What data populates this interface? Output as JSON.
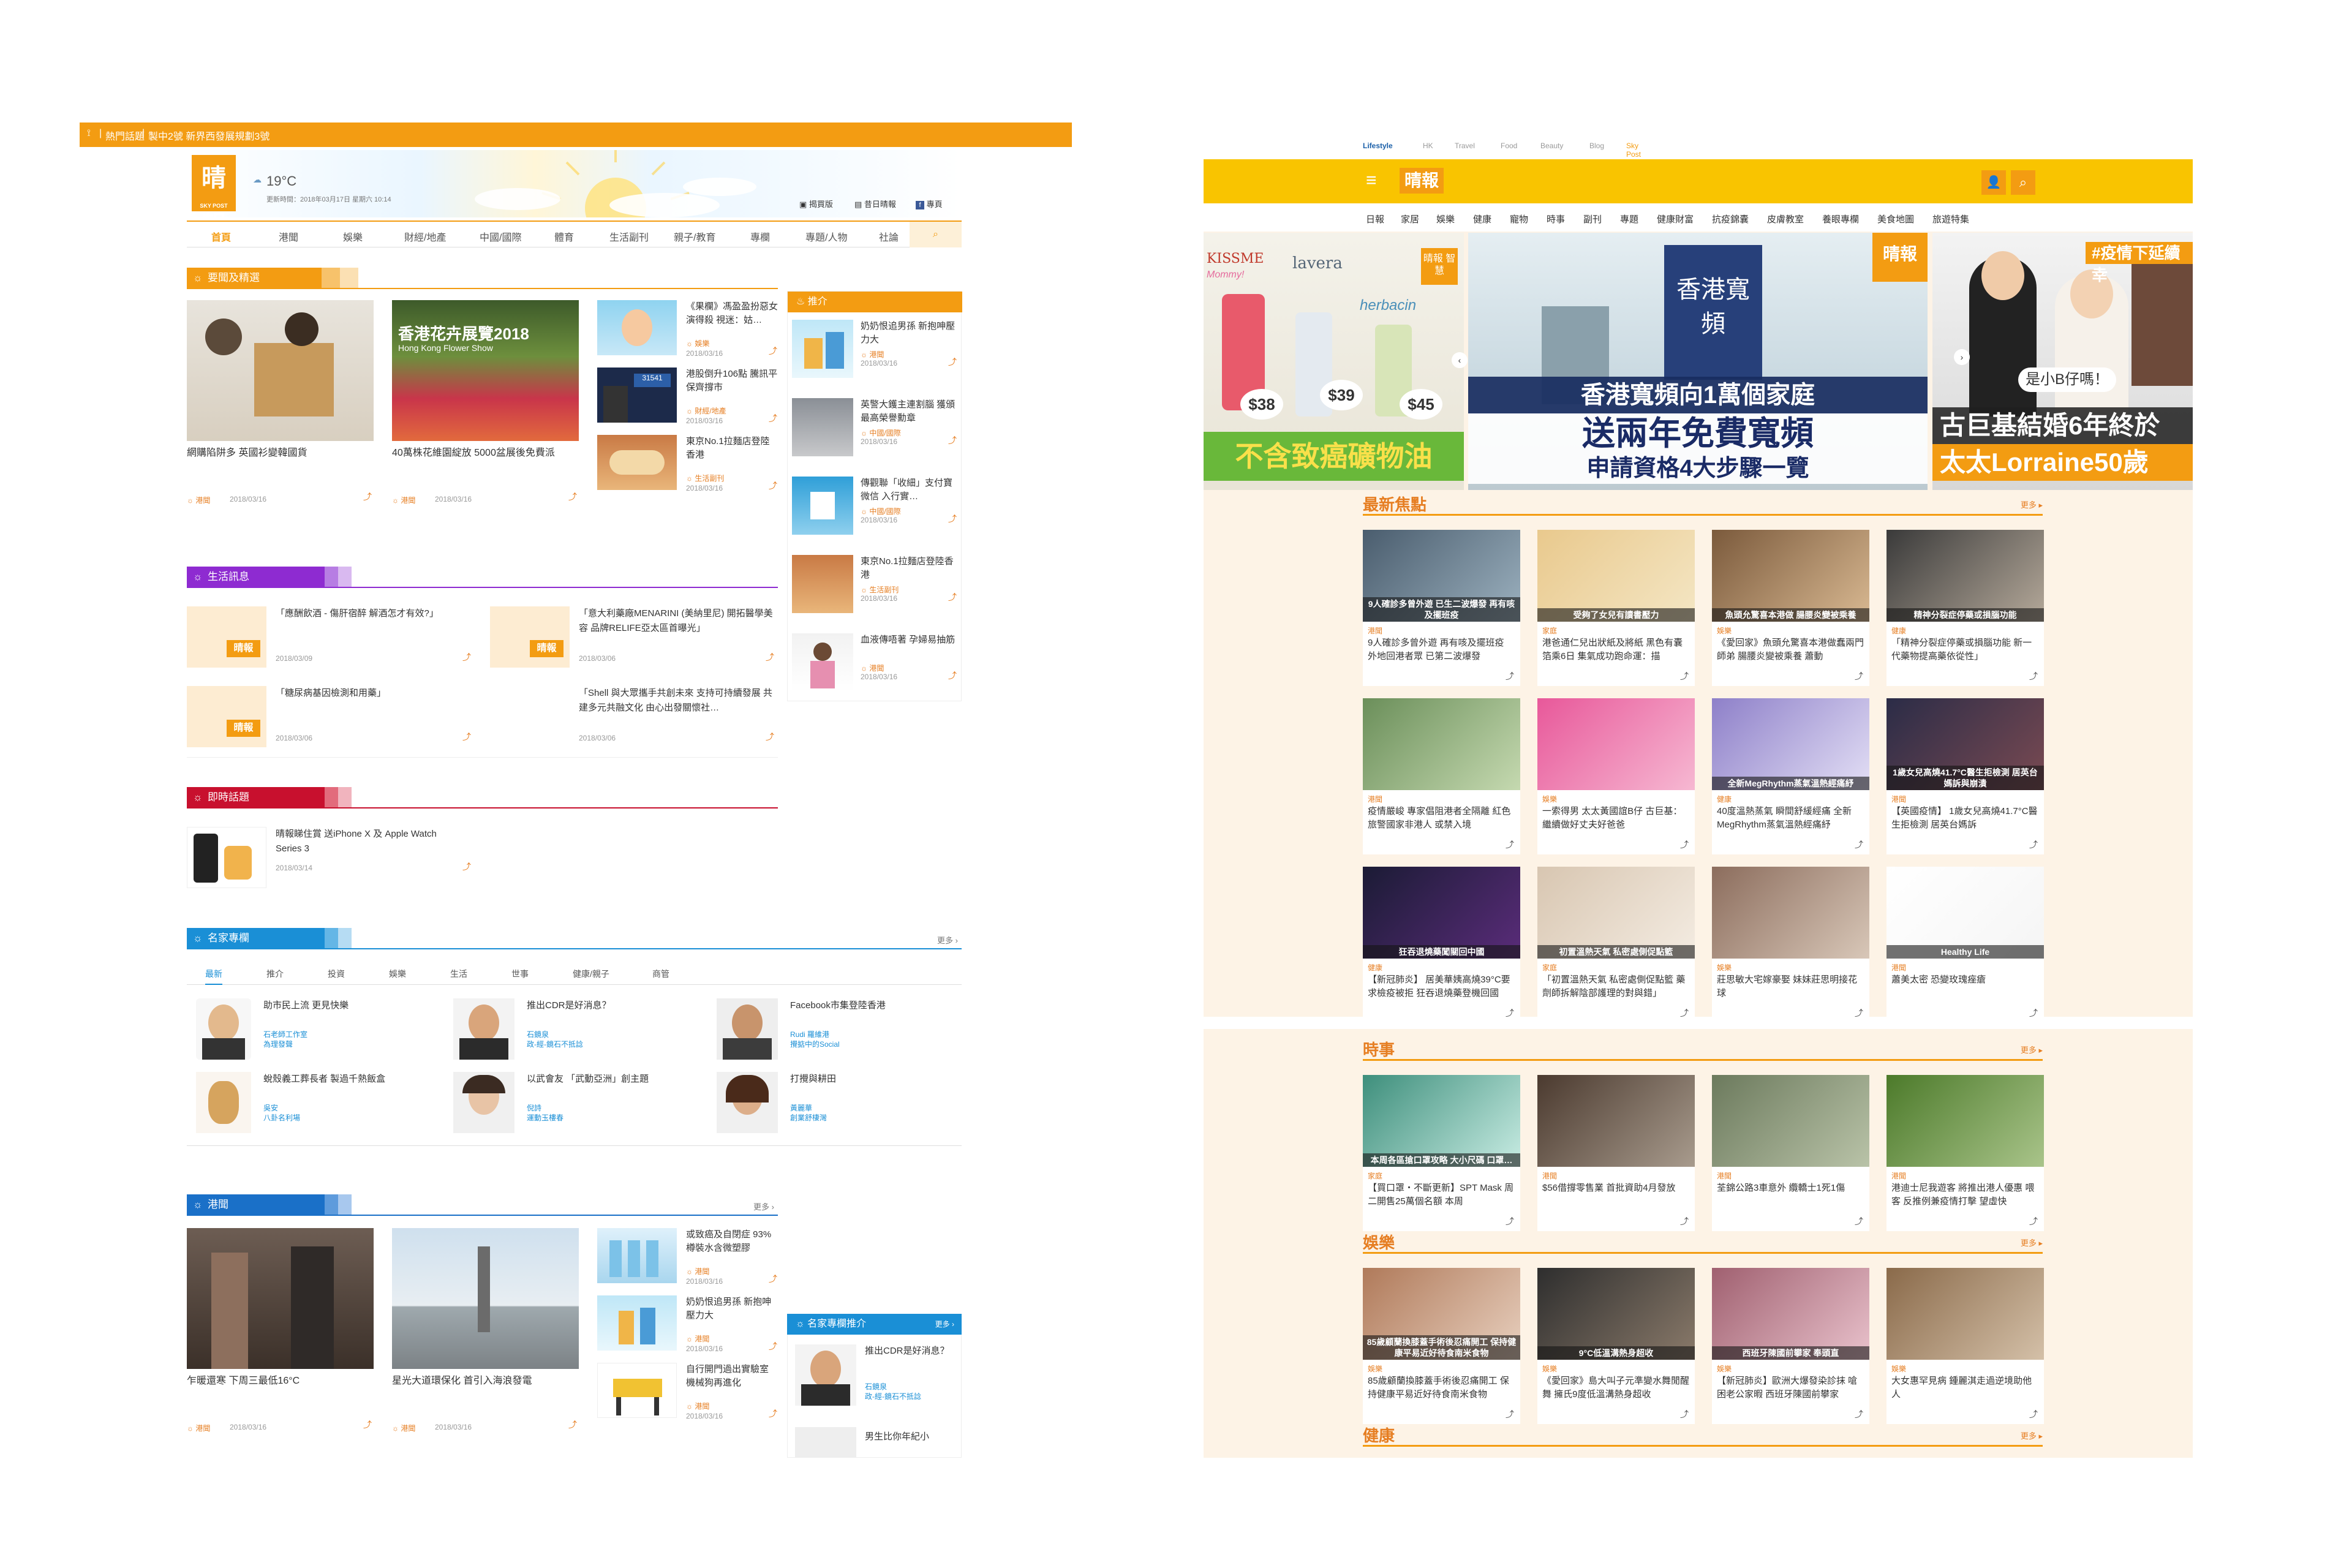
{
  "left": {
    "topbar": {
      "rss": "rss-icon",
      "hot_label": "熱門話題",
      "sep": "|",
      "hot_text": "製中2號 新界西發展規劃3號"
    },
    "header": {
      "logo": "晴報",
      "logo_sub": "SKY POST",
      "temp": "19°C",
      "update_time": "更新時間：2018年03月17日 星期六 10:14",
      "links": [
        "揭買版",
        "昔日晴報",
        "專頁"
      ]
    },
    "nav": [
      "首頁",
      "港聞",
      "娛樂",
      "財經/地產",
      "中國/國際",
      "體育",
      "生活副刊",
      "親子/教育",
      "專欄",
      "專題/人物",
      "社論"
    ],
    "top_section": {
      "title": "要聞及精選",
      "main": [
        {
          "title": "網購陷阱多 英國衫變韓國貨",
          "cat": "港聞",
          "date": "2018/03/16"
        },
        {
          "title": "40萬株花維園綻放 5000盆展後免費派",
          "cat": "港聞",
          "date": "2018/03/16"
        }
      ],
      "side": [
        {
          "title": "《果欄》馮盈盈扮惡女演得殺 視迷：姑…",
          "cat": "娛樂",
          "date": "2018/03/16"
        },
        {
          "title": "港股倒升106點 騰訊平保齊撐市",
          "cat": "財經/地產",
          "date": "2018/03/16"
        },
        {
          "title": "東京No.1拉麵店登陸香港",
          "cat": "生活副刊",
          "date": "2018/03/16"
        }
      ]
    },
    "recommend": {
      "title": "推介",
      "items": [
        {
          "title": "奶奶恨追男孫 新抱呻壓力大",
          "cat": "港聞",
          "date": "2018/03/16"
        },
        {
          "title": "英警大鑊主連割腦 獲頒最高榮譽勳章",
          "cat": "中國/國際",
          "date": "2018/03/16"
        },
        {
          "title": "傳觀聯「收細」支付寶微信 入行實…",
          "cat": "中國/國際",
          "date": "2018/03/16"
        },
        {
          "title": "東京No.1拉麵店登陸香港",
          "cat": "生活副刊",
          "date": "2018/03/16"
        },
        {
          "title": "血液傳唔著 孕婦易抽筋",
          "cat": "港聞",
          "date": "2018/03/16"
        }
      ]
    },
    "life": {
      "title": "生活訊息",
      "items": [
        {
          "title": "「應酬飲酒 - 傷肝宿醉 解酒怎才有效?」",
          "date": "2018/03/09"
        },
        {
          "title": "「意大利藥廠MENARINI (美納里尼) 開拓醫學美容 品牌RELIFE亞太區首曝光」",
          "date": "2018/03/06"
        },
        {
          "title": "「糖尿病基因檢測和用藥」",
          "date": "2018/03/06"
        },
        {
          "title": "「Shell 與大眾攜手共創未來 支持可持續發展 共建多元共融文化 由心出發關懷社…",
          "date": "2018/03/06"
        }
      ],
      "placeholder_logo": "晴報"
    },
    "hot": {
      "title": "即時話題",
      "item": {
        "title": "晴報睇住賞 送iPhone X 及 Apple Watch Series 3",
        "date": "2018/03/14"
      }
    },
    "columnists": {
      "title": "名家專欄",
      "more": "更多",
      "tabs": [
        "最新",
        "推介",
        "投資",
        "娛樂",
        "生活",
        "世事",
        "健康/親子",
        "商管"
      ],
      "items": [
        {
          "title": "助市民上流 更見快樂",
          "author": "石老師工作室",
          "column": "為理發聲"
        },
        {
          "title": "推出CDR是好消息？",
          "author": "石鏡泉",
          "column": "政-經-鏡石不抵諗"
        },
        {
          "title": "Facebook市集登陸香港",
          "author": "Rudi 羅維港",
          "column": "攪掂中的Social"
        },
        {
          "title": "蛻殼義工葬長者 製過千熱飯盒",
          "author": "吳安",
          "column": "八卦名利場"
        },
        {
          "title": "以武會友 「武動亞洲」創主題",
          "author": "倪詩",
          "column": "運動玉樓春"
        },
        {
          "title": "打攪與耕田",
          "author": "黃麗華",
          "column": "創業舒棲灣"
        }
      ]
    },
    "local": {
      "title": "港聞",
      "more": "更多",
      "main": [
        {
          "title": "乍暖還寒 下周三最低16°C",
          "cat": "港聞",
          "date": "2018/03/16"
        },
        {
          "title": "星光大道環保化 首引入海浪發電",
          "cat": "港聞",
          "date": "2018/03/16"
        }
      ],
      "side": [
        {
          "title": "或致癌及自閉症 93%樽裝水含微塑膠",
          "cat": "港聞",
          "date": "2018/03/16"
        },
        {
          "title": "奶奶恨追男孫 新抱呻壓力大",
          "cat": "港聞",
          "date": "2018/03/16"
        },
        {
          "title": "自行開門過出實驗室 機械狗再進化",
          "cat": "港聞",
          "date": "2018/03/16"
        }
      ]
    },
    "column_rec": {
      "title": "名家專欄推介",
      "more": "更多",
      "items": [
        {
          "title": "推出CDR是好消息？",
          "author": "石鏡泉",
          "column": "政-經-鏡石不抵諗"
        },
        {
          "title": "男生比你年紀小",
          "author": "",
          "column": ""
        }
      ]
    }
  },
  "right": {
    "brands": {
      "logo": "Lifestyle",
      "items": [
        "HK",
        "Travel",
        "Food",
        "Beauty",
        "Blog",
        "Sky Post"
      ]
    },
    "logo": "晴報",
    "menu": [
      "日報",
      "家居",
      "娛樂",
      "健康",
      "寵物",
      "時事",
      "副刊",
      "專題",
      "健康財富",
      "抗疫錦囊",
      "皮膚教室",
      "養眼專欄",
      "美食地圖",
      "旅遊特集"
    ],
    "hero": [
      {
        "brand1": "KISSME",
        "brand1b": "Mommy!",
        "brand2": "lavera",
        "brand3": "herbacin",
        "prices": [
          "$38",
          "$39",
          "$45"
        ],
        "headline": "不含致癌礦物油",
        "badge": "晴報 智慧"
      },
      {
        "line1": "香港寬頻向1萬個家庭",
        "line2": "送兩年免費寬頻",
        "line3": "申請資格4大步驟一覽",
        "sign": "香港寬頻",
        "badge": "晴報"
      },
      {
        "tag": "#疫情下延續幸",
        "bubble": "是小B仔嗎！",
        "line1": "古巨基結婚6年終於",
        "line2": "太太Lorraine50歲"
      }
    ],
    "sections": [
      {
        "title": "最新焦點",
        "more": "更多",
        "cards": [
          {
            "cat": "港聞",
            "title": "9人確診多曾外遊 再有咳及擺班疫 外地回港者眾 已第二波爆發",
            "overlay": "9人確診多曾外遊 已生二波爆發 再有咳及擺班疫"
          },
          {
            "cat": "家庭",
            "title": "港爸通仁兒出狀紙及將紙 黑色有囊箔乘6日 集氣成功跑命運：描",
            "overlay": "受夠了女兒有讀書壓力"
          },
          {
            "cat": "娛樂",
            "title": "《愛回家》魚頭允驚喜本港做蠢兩門師弟 腸腰炎變被乘養 蕭動",
            "overlay": "魚頭允驚喜本港做 腸腰炎變被乘養"
          },
          {
            "cat": "健康",
            "title": "「精神分裂症停藥或損腦功能 新一代藥物提高藥依從性」",
            "overlay": "精神分裂症停藥或損腦功能"
          },
          {
            "cat": "港聞",
            "title": "疫情嚴峻 專家倡阻港者全隔離 紅色旅警國家非港人 或禁入境",
            "overlay": ""
          },
          {
            "cat": "娛樂",
            "title": "一索得男 太太黃國誼B仔 古巨基：繼續做好丈夫好爸爸",
            "overlay": ""
          },
          {
            "cat": "健康",
            "title": "40度溫熱蒸氣 瞬間舒緩經痛 全新MegRhythm蒸氣溫熱經痛紓",
            "overlay": "全新MegRhythm蒸氣溫熱經痛紓"
          },
          {
            "cat": "港聞",
            "title": "【英國疫情】 1歲女兒高燒41.7°C醫生拒檢測 居英台媽訴",
            "overlay": "1歲女兒高燒41.7°C醫生拒檢測 居英台媽訴與崩潰"
          },
          {
            "cat": "健康",
            "title": "【新冠肺炎】 居美華姨高燒39°C要求檢疫被拒 狂吞退燒藥登機回國",
            "overlay": "狂吞退燒藥闖關回中國"
          },
          {
            "cat": "家庭",
            "title": "「初置溫熱天氣 私密處側促點籃 藥劑師拆解陰部護理的對與錯」",
            "overlay": "初置溫熱天氣 私密處側促點籃"
          },
          {
            "cat": "娛樂",
            "title": "莊思敏大宅嫁豪娶 妹妹莊思明接花球",
            "overlay": ""
          },
          {
            "cat": "港聞",
            "title": "蕭美太密 恐變玫瑰痤瘡",
            "overlay": "Healthy Life"
          }
        ]
      },
      {
        "title": "時事",
        "more": "更多",
        "cards": [
          {
            "cat": "家庭",
            "title": "【買口罩・不斷更新】SPT Mask 周二開售25萬個名額 本周",
            "overlay": "本周各區搶口罩攻略 大小尺碼 口罩…"
          },
          {
            "cat": "港聞",
            "title": "$56借撐零售業 首批資助4月發放",
            "overlay": ""
          },
          {
            "cat": "港聞",
            "title": "荃錦公路3車意外 纜轎士1死1傷",
            "overlay": ""
          },
          {
            "cat": "港聞",
            "title": "港迪士尼我遊客 將推出港人優惠 喂客 反推例兼疫情打擊 望虛快",
            "overlay": ""
          }
        ]
      },
      {
        "title": "娛樂",
        "more": "更多",
        "cards": [
          {
            "cat": "娛樂",
            "title": "85歲顧蘭換膝蓋手術後忍痛開工 保持健康平易近好待食南米食物",
            "overlay": "85歲顧蘭換膝蓋手術後忍痛開工 保持健康平易近好待食南米食物"
          },
          {
            "cat": "娛樂",
            "title": "《愛回家》島大叫子元準變水舞閒醒舞 擁氏9度低溫溝熱身超收",
            "overlay": "9°C低溫溝熱身超收"
          },
          {
            "cat": "娛樂",
            "title": "【新冠肺炎】歐洲大爆發染診抹 嗆困老公家暇 西班牙陳國前攀家",
            "overlay": "西班牙陳國前攀家 奉頭直"
          },
          {
            "cat": "娛樂",
            "title": "大女惠罕見病 鍾麗淇走過逆境助他人",
            "overlay": ""
          }
        ]
      },
      {
        "title": "健康",
        "more": "更多",
        "cards": []
      }
    ]
  },
  "colors": {
    "orange": "#f39c12",
    "purple": "#8e2bd1",
    "red": "#c8102e",
    "blue": "#1a8fd6",
    "navy": "#1a70c8",
    "yellow": "#f9c400"
  }
}
